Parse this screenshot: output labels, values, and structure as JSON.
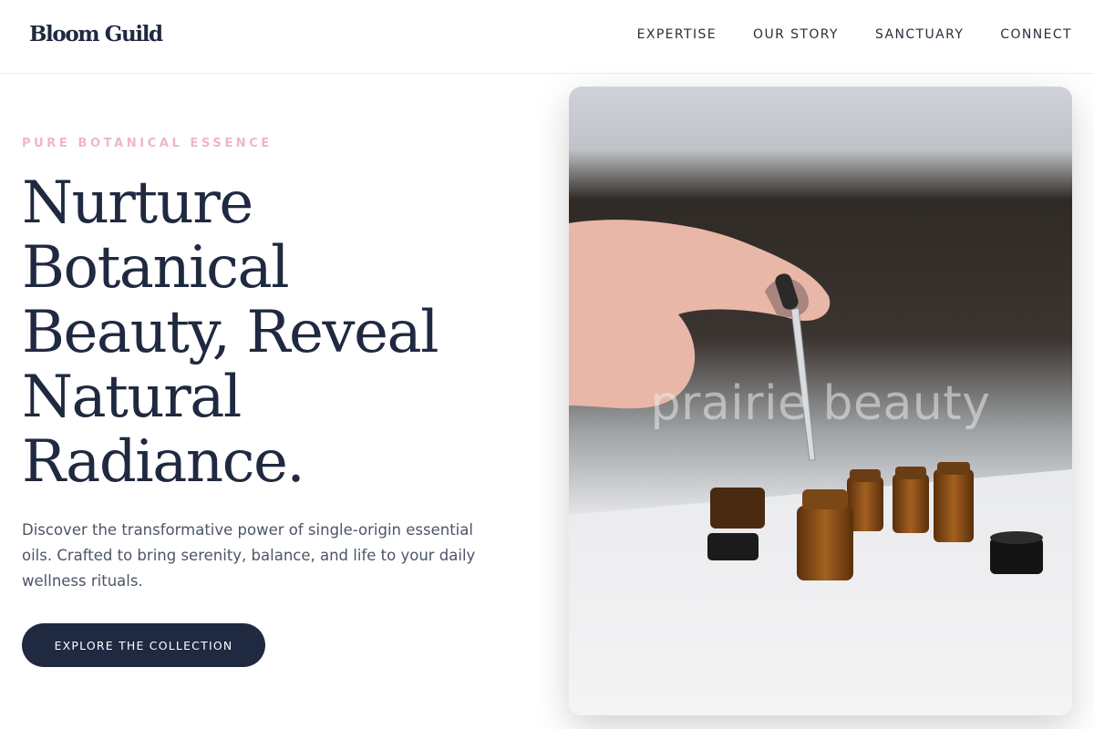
{
  "header": {
    "brand": "Bloom Guild",
    "nav": [
      "EXPERTISE",
      "OUR STORY",
      "SANCTUARY",
      "CONNECT"
    ]
  },
  "hero": {
    "eyebrow": "PURE BOTANICAL ESSENCE",
    "headline_lines": [
      "Nurture",
      "Botanical",
      "Beauty, Reveal",
      "Natural",
      "Radiance."
    ],
    "lede": "Discover the transformative power of single-origin essential oils. Crafted to bring serenity, balance, and life to your daily wellness rituals.",
    "cta_label": "EXPLORE THE COLLECTION"
  },
  "photo": {
    "watermark": "prairie beauty"
  },
  "colors": {
    "navy": "#1f2940",
    "pink": "#efb5c9",
    "body_text": "#4c5567",
    "amber": "#8a4c16"
  }
}
